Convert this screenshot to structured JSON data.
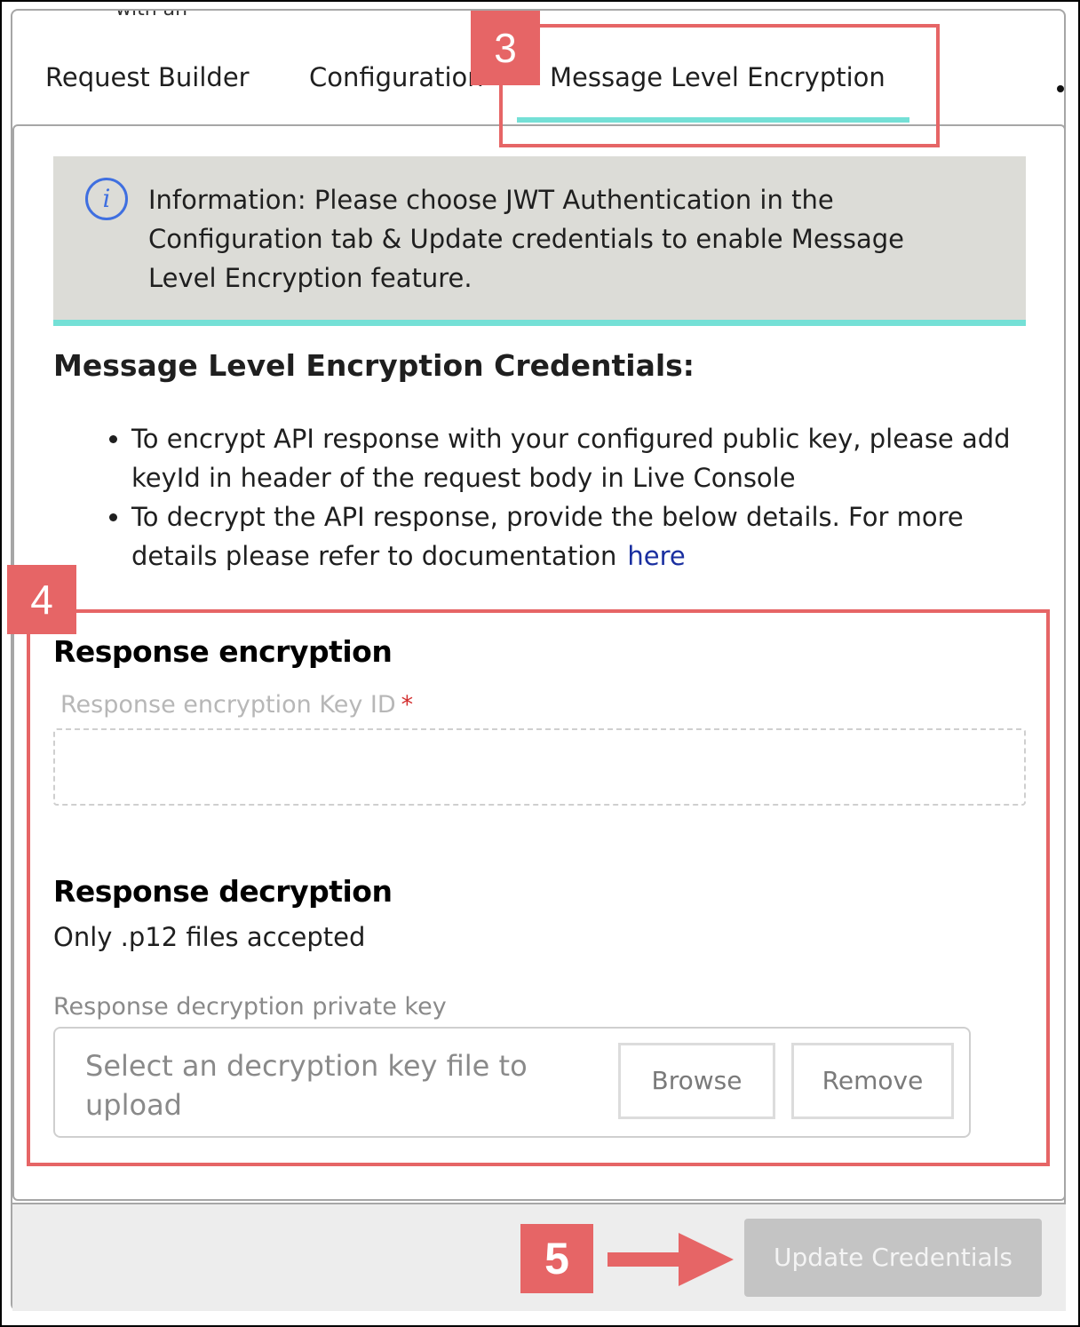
{
  "top_cut_text": "with an",
  "tabs": [
    {
      "label": "Request Builder"
    },
    {
      "label": "Configuration"
    },
    {
      "label": "Message Level Encryption"
    }
  ],
  "info": {
    "icon": "info-icon",
    "icon_glyph": "i",
    "text": "Information: Please choose JWT Authentication in the Configuration tab & Update credentials to enable Message Level Encryption feature."
  },
  "credentials": {
    "title": "Message Level Encryption Credentials:",
    "bullets": [
      "To encrypt API response with your configured public key, please add keyId in header of the request body in Live Console",
      "To decrypt the API response, provide the below details. For more details please refer to documentation"
    ],
    "link_text": "here"
  },
  "response_encryption": {
    "title": "Response encryption",
    "key_id_label": "Response encryption Key ID",
    "required_mark": "*",
    "key_id_value": ""
  },
  "response_decryption": {
    "title": "Response decryption",
    "note": "Only .p12 files accepted",
    "private_key_label": "Response decryption private key",
    "file_placeholder": "Select an decryption key file to upload",
    "browse_label": "Browse",
    "remove_label": "Remove"
  },
  "footer": {
    "update_label": "Update Credentials"
  },
  "callouts": {
    "tab_badge": "3",
    "form_badge": "4",
    "button_badge": "5",
    "color": "#e66566"
  },
  "colors": {
    "accent": "#74e0d6",
    "link": "#1a2fa0",
    "info_bg": "#dcdcd7",
    "disabled_button": "#c4c4c4"
  }
}
